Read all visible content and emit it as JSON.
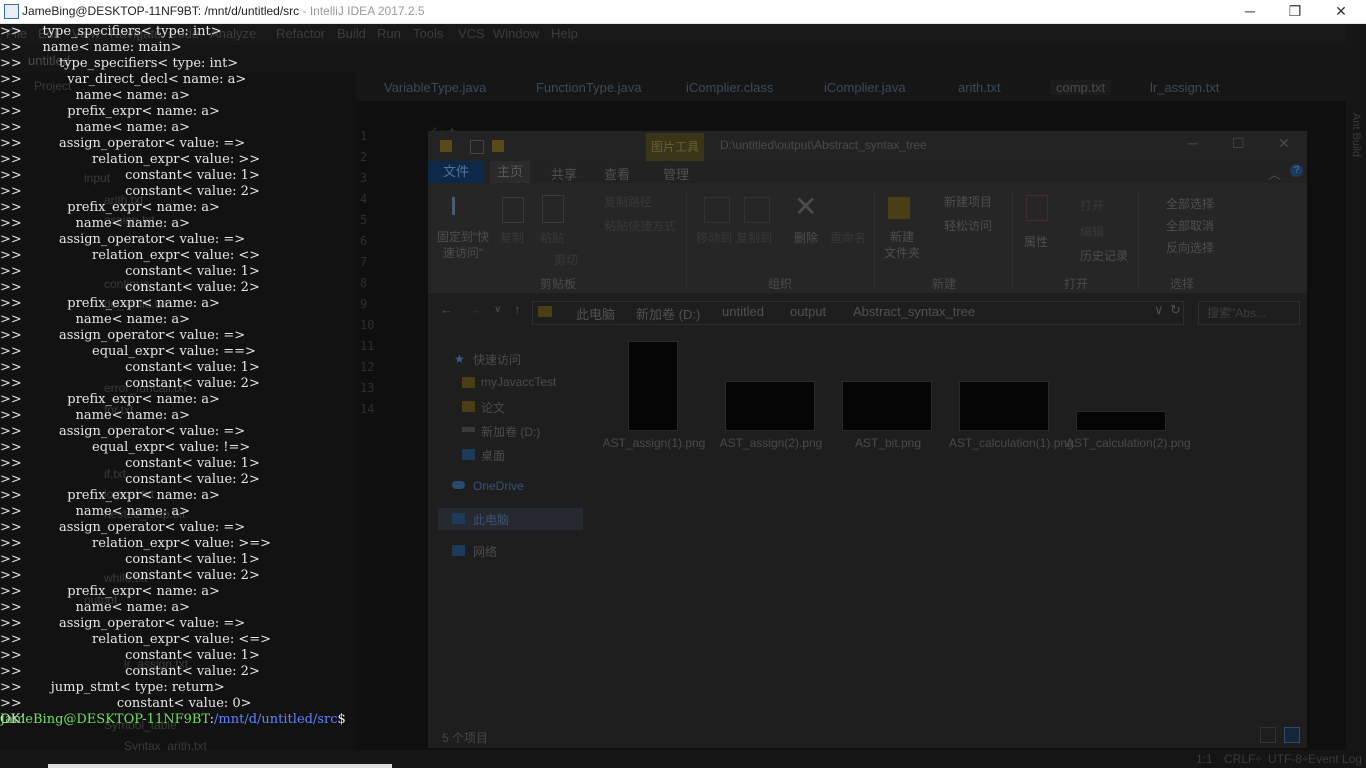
{
  "window": {
    "title": "JameBing@DESKTOP-11NF9BT: /mnt/d/untitled/src",
    "title_dim": " - IntelliJ IDEA 2017.2.5",
    "controls": [
      "─",
      "❐",
      "✕"
    ]
  },
  "ide": {
    "menu": [
      "File",
      "Edit",
      "View",
      "Navigate",
      "Code",
      "Analyze",
      "Refactor",
      "Build",
      "Run",
      "Tools",
      "VCS",
      "Window",
      "Help"
    ],
    "project_name": "untitled",
    "project_panel_label": "Project",
    "tree": [
      {
        "label": "input"
      },
      {
        "label": "arith.txt"
      },
      {
        "label": "assign.txt"
      },
      {
        "label": "continue"
      },
      {
        "label": "do_while.txt"
      },
      {
        "label": "error_funcall.txt"
      },
      {
        "label": "for.txt"
      },
      {
        "label": "if.txt"
      },
      {
        "label": "logical.txt"
      },
      {
        "label": "nested_loop.txt"
      },
      {
        "label": "while.txt"
      },
      {
        "label": "output"
      },
      {
        "label": "Symbol_table"
      },
      {
        "label": "Syntax_arith.txt"
      },
      {
        "label": "lr_assign.txt"
      }
    ],
    "tabs": [
      "VariableType.java",
      "FunctionType.java",
      "iComplier.class",
      "iComplier.java",
      "arith.txt",
      "comp.txt",
      "lr_assign.txt"
    ],
    "active_tab": "comp.txt",
    "gutter": [
      "1",
      "2",
      "3",
      "4",
      "5",
      "6",
      "7",
      "8",
      "9",
      "10",
      "11",
      "12",
      "13",
      "14"
    ],
    "code_keyword": "int",
    "right_strip_label": "Ant Build",
    "status": {
      "position": "1:1",
      "line_sep": "CRLF÷",
      "encoding": "UTF-8÷",
      "event_log": "Event Log"
    }
  },
  "explorer": {
    "tools_tab": "图片工具",
    "path_title": "D:\\untitled\\output\\Abstract_syntax_tree",
    "ribbon_tabs": [
      "文件",
      "主页",
      "共享",
      "查看",
      "管理"
    ],
    "ribbon": {
      "clipboard": {
        "pin": "固定到\"快\n速访问\"",
        "copy": "复制",
        "paste": "粘贴",
        "copy_path": "复制路径",
        "paste_shortcut": "粘贴快捷方式",
        "cut": "剪切",
        "group": "剪贴板"
      },
      "organize": {
        "move_to": "移动到",
        "copy_to": "复制到",
        "delete": "删除",
        "rename": "重命名",
        "group": "组织"
      },
      "new": {
        "new_folder": "新建\n文件夹",
        "new_item": "新建项目",
        "easy_access": "轻松访问",
        "group": "新建"
      },
      "open": {
        "properties": "属性",
        "open": "打开",
        "edit": "编辑",
        "history": "历史记录",
        "group": "打开"
      },
      "select": {
        "select_all": "全部选择",
        "select_none": "全部取消",
        "invert": "反向选择",
        "group": "选择"
      }
    },
    "breadcrumbs": [
      "此电脑",
      "新加卷 (D:)",
      "untitled",
      "output",
      "Abstract_syntax_tree"
    ],
    "search_placeholder": "搜索\"Abs...",
    "nav": [
      {
        "label": "快速访问"
      },
      {
        "label": "myJavaccTest"
      },
      {
        "label": "论文"
      },
      {
        "label": "新加卷 (D:)"
      },
      {
        "label": "桌面"
      },
      {
        "label": "OneDrive"
      },
      {
        "label": "此电脑"
      },
      {
        "label": "网络"
      }
    ],
    "files": [
      {
        "name": "AST_assign(1).png"
      },
      {
        "name": "AST_assign(2).png"
      },
      {
        "name": "AST_bit.png"
      },
      {
        "name": "AST_calculation(1).png"
      },
      {
        "name": "AST_calculation(2).png"
      }
    ],
    "status": "5 个项目"
  },
  "terminal": {
    "lines": [
      ">>     type_specifiers< type: int>",
      ">>     name< name: main>",
      ">>         type_specifiers< type: int>",
      ">>           var_direct_decl< name: a>",
      ">>             name< name: a>",
      ">>           prefix_expr< name: a>",
      ">>             name< name: a>",
      ">>         assign_operator< value: =>",
      ">>                 relation_expr< value: >>",
      ">>                         constant< value: 1>",
      ">>                         constant< value: 2>",
      ">>           prefix_expr< name: a>",
      ">>             name< name: a>",
      ">>         assign_operator< value: =>",
      ">>                 relation_expr< value: <>",
      ">>                         constant< value: 1>",
      ">>                         constant< value: 2>",
      ">>           prefix_expr< name: a>",
      ">>             name< name: a>",
      ">>         assign_operator< value: =>",
      ">>                 equal_expr< value: ==>",
      ">>                         constant< value: 1>",
      ">>                         constant< value: 2>",
      ">>           prefix_expr< name: a>",
      ">>             name< name: a>",
      ">>         assign_operator< value: =>",
      ">>                 equal_expr< value: !=>",
      ">>                         constant< value: 1>",
      ">>                         constant< value: 2>",
      ">>           prefix_expr< name: a>",
      ">>             name< name: a>",
      ">>         assign_operator< value: =>",
      ">>                 relation_expr< value: >=>",
      ">>                         constant< value: 1>",
      ">>                         constant< value: 2>",
      ">>           prefix_expr< name: a>",
      ">>             name< name: a>",
      ">>         assign_operator< value: =>",
      ">>                 relation_expr< value: <=>",
      ">>                         constant< value: 1>",
      ">>                         constant< value: 2>",
      ">>       jump_stmt< type: return>",
      ">>                       constant< value: 0>",
      "OK!"
    ],
    "prompt_user": "JameBing@DESKTOP-11NF9BT",
    "prompt_sep": ":",
    "prompt_path": "/mnt/d/untitled/src",
    "prompt_symbol": "$"
  },
  "colors": {
    "prompt_user": "#6fe060",
    "prompt_path": "#5c84ff",
    "explorer_file_tab": "#0c2a47"
  }
}
